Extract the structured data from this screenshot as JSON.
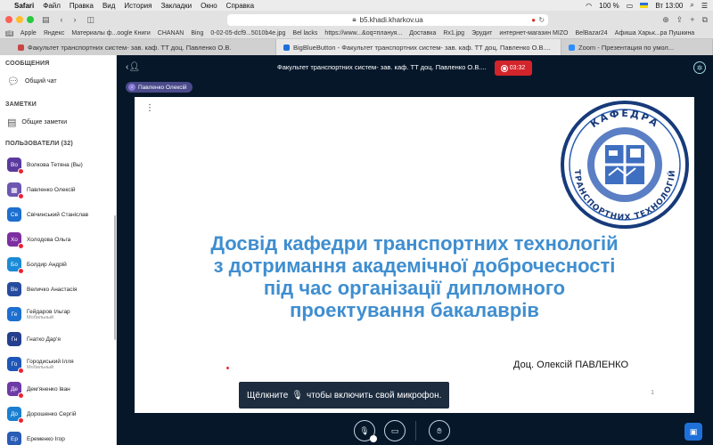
{
  "menubar": {
    "app": "Safari",
    "items": [
      "Файл",
      "Правка",
      "Вид",
      "История",
      "Закладки",
      "Окно",
      "Справка"
    ],
    "battery": "100 %",
    "clock": "Вт 13:00"
  },
  "toolbar": {
    "url": "b5.khadi.kharkov.ua"
  },
  "bookmarks": [
    "Apple",
    "Яндекс",
    "Материалы ф...oogle Книги",
    "CHANAN",
    "Bing",
    "0-02-05-dcf9...5010b4e.jpg",
    "Bel lacks",
    "https://www...&oq=плануя...",
    "Доставка",
    "Rx1.jpg",
    "Эрудит",
    "интернет-магазин MIZO",
    "BelBazar24",
    "Афиша Харьк...ра Пушкина"
  ],
  "tabs": [
    {
      "label": "Факультет транспортних систем- зав. каф. ТТ доц. Павленко О.В."
    },
    {
      "label": "BigBlueButton - Факультет транспортних систем- зав. каф. ТТ доц. Павленко О.В...."
    },
    {
      "label": "Zoom - Презентация по умол..."
    }
  ],
  "sidebar": {
    "messages_title": "СООБЩЕНИЯ",
    "chat_label": "Общий чат",
    "notes_title": "ЗАМЕТКИ",
    "notes_label": "Общие заметки",
    "users_title": "ПОЛЬЗОВАТЕЛИ (32)",
    "users": [
      {
        "initials": "Во",
        "name": "Волкова Тетяна (Вы)",
        "sub": "",
        "color": "#5b3a9e"
      },
      {
        "initials": "",
        "name": "Павленко Олексій",
        "sub": "",
        "color": "#6d56b0"
      },
      {
        "initials": "Св",
        "name": "Свічинський Станіслав",
        "sub": "",
        "color": "#1d6fd0"
      },
      {
        "initials": "Хо",
        "name": "Холодова Ольга",
        "sub": "",
        "color": "#7d2fa0"
      },
      {
        "initials": "Бо",
        "name": "Болдир Андрій",
        "sub": "",
        "color": "#1b8ad6"
      },
      {
        "initials": "Ве",
        "name": "Величко Анастасія",
        "sub": "",
        "color": "#264c9e"
      },
      {
        "initials": "Ге",
        "name": "Гейдаров Ільгар",
        "sub": "Мобильный",
        "color": "#1d6fd0"
      },
      {
        "initials": "Гн",
        "name": "Гнатко Дар'я",
        "sub": "",
        "color": "#243f8e"
      },
      {
        "initials": "Го",
        "name": "Городиський Ілля",
        "sub": "Мобильный",
        "color": "#1f56b8"
      },
      {
        "initials": "Де",
        "name": "Дем'яненко Іван",
        "sub": "",
        "color": "#6e3aa6"
      },
      {
        "initials": "До",
        "name": "Дорошенко Сергій",
        "sub": "",
        "color": "#1a7fd0"
      },
      {
        "initials": "Ер",
        "name": "Еременко Ігор",
        "sub": "",
        "color": "#2a5bb5"
      }
    ]
  },
  "meeting": {
    "title": "Факультет транспортних систем- зав. каф. ТТ доц. Павленко О.В....",
    "timer": "03:32",
    "talking": "Павленко Олексій"
  },
  "slide": {
    "line1": "Досвід кафедри транспортних технологій",
    "line2": "з дотримання академічної доброчесності",
    "line3": "під час організації дипломного",
    "line4": "проектування бакалаврів",
    "author": "Доц. Олексій ПАВЛЕНКО",
    "page": "1",
    "logo_top": "КАФЕДРА",
    "logo_bottom": "ТРАНСПОРТНИХ ТЕХНОЛОГІЙ"
  },
  "tooltip": {
    "before": "Щёлкните",
    "after": "чтобы включить свой микрофон."
  }
}
